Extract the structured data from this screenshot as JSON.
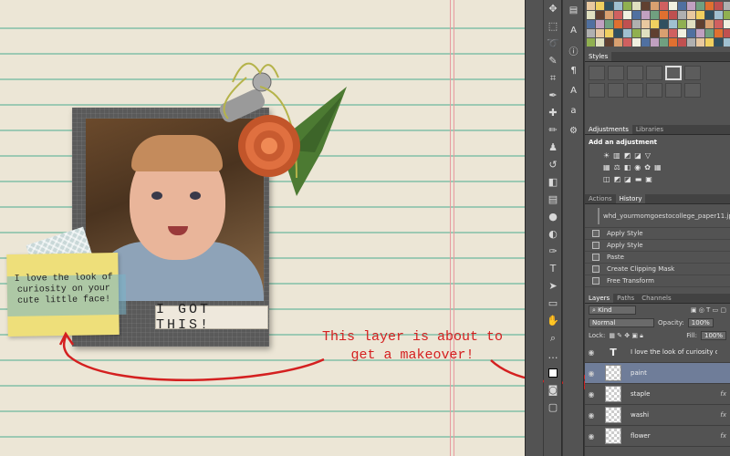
{
  "canvas": {
    "note_text": "I love the look of curiosity on your cute little face!",
    "frame_caption": "I GOT THIS!",
    "annotation": "This layer is about to get a makeover!"
  },
  "colors": {
    "paper": "#ece6d6",
    "ruled_line": "#9cc9b3",
    "margin_line": "#e79aa0",
    "annotation_red": "#d42020",
    "selected_layer": "#6f7d99"
  },
  "tools": [
    "move-tool",
    "marquee-tool",
    "lasso-tool",
    "quick-select-tool",
    "crop-tool",
    "eyedropper-tool",
    "healing-brush-tool",
    "brush-tool",
    "clone-stamp-tool",
    "history-brush-tool",
    "eraser-tool",
    "gradient-tool",
    "blur-tool",
    "dodge-tool",
    "pen-tool",
    "type-tool",
    "path-select-tool",
    "shape-tool",
    "hand-tool",
    "zoom-tool"
  ],
  "styles_panel": {
    "title": "Styles"
  },
  "adjustments_panel": {
    "tabs": [
      "Adjustments",
      "Libraries"
    ],
    "header": "Add an adjustment"
  },
  "history_panel": {
    "tabs": [
      "Actions",
      "History"
    ],
    "snapshot": "whd_yourmomgoestocollege_paper11.jpg",
    "items": [
      "Apply Style",
      "Apply Style",
      "Paste",
      "Create Clipping Mask",
      "Free Transform"
    ]
  },
  "layers_panel": {
    "tabs": [
      "Layers",
      "Paths",
      "Channels"
    ],
    "kind_filter": "Kind",
    "blend_mode": "Normal",
    "opacity_label": "Opacity:",
    "opacity_value": "100%",
    "lock_label": "Lock:",
    "fill_label": "Fill:",
    "fill_value": "100%",
    "layers": [
      {
        "name": "I love the look of curiosity on your cute...",
        "type": "text",
        "fx": ""
      },
      {
        "name": "paint",
        "type": "pixel",
        "fx": "",
        "selected": true
      },
      {
        "name": "staple",
        "type": "pixel",
        "fx": "fx"
      },
      {
        "name": "washi",
        "type": "pixel",
        "fx": "fx"
      },
      {
        "name": "flower",
        "type": "pixel",
        "fx": "fx"
      }
    ]
  }
}
